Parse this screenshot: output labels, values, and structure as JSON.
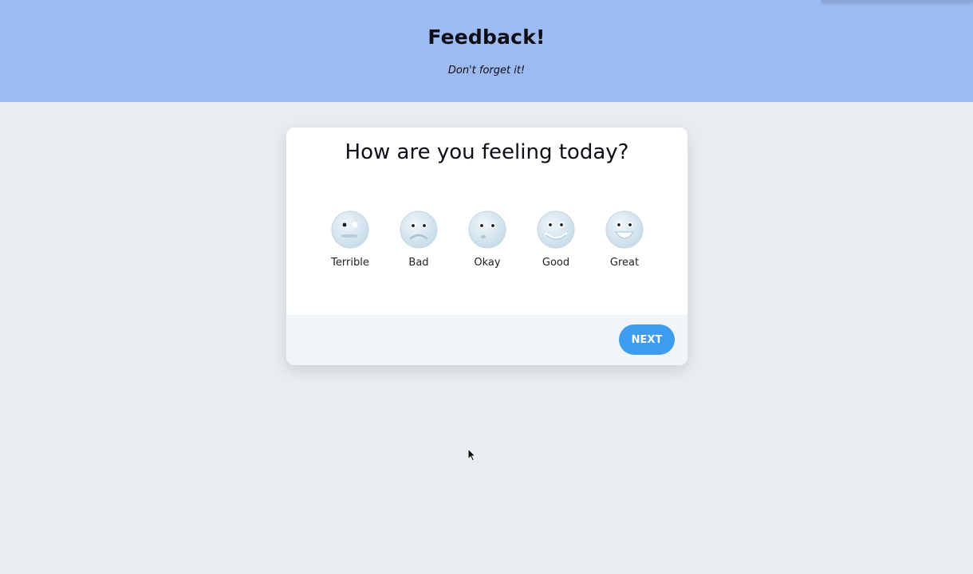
{
  "header": {
    "title": "Feedback!",
    "subtitle": "Don't forget it!"
  },
  "card": {
    "question": "How are you feeling today?",
    "options": [
      {
        "label": "Terrible",
        "icon": "terrible-face-icon"
      },
      {
        "label": "Bad",
        "icon": "bad-face-icon"
      },
      {
        "label": "Okay",
        "icon": "okay-face-icon"
      },
      {
        "label": "Good",
        "icon": "good-face-icon"
      },
      {
        "label": "Great",
        "icon": "great-face-icon"
      }
    ],
    "next_label": "NEXT"
  },
  "colors": {
    "header_bg": "#9dbbf0",
    "page_bg": "#e9ecf0",
    "button_bg": "#3d9bf0",
    "face_fill": "#d6e6ef"
  }
}
